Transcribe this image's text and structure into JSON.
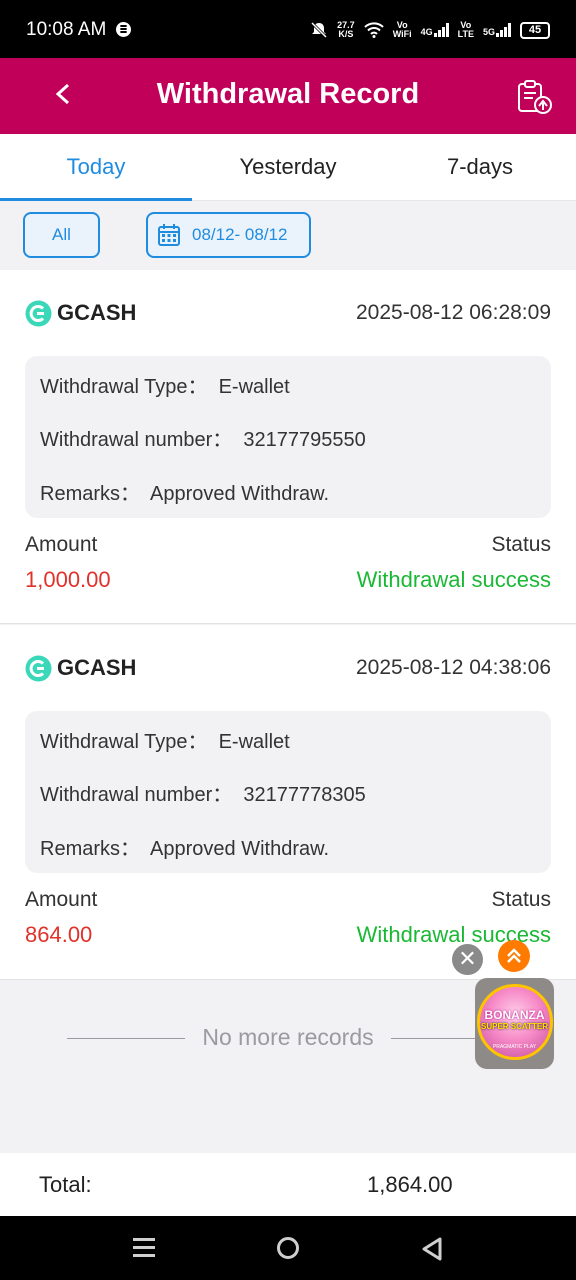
{
  "status_bar": {
    "time": "10:08 AM",
    "net_speed": "27.7",
    "net_unit": "K/S",
    "wifi_label_top": "Vo",
    "wifi_label_bottom": "WiFi",
    "lte_label": "4G",
    "lte_label_top": "Vo",
    "lte_label_bottom": "LTE",
    "fiveg_label": "5G",
    "battery": "45"
  },
  "header": {
    "title": "Withdrawal Record"
  },
  "tabs": [
    {
      "label": "Today",
      "active": true
    },
    {
      "label": "Yesterday",
      "active": false
    },
    {
      "label": "7-days",
      "active": false
    }
  ],
  "filter": {
    "all_label": "All",
    "date_range": "08/12- 08/12"
  },
  "records": [
    {
      "method": "GCASH",
      "datetime": "2025-08-12 06:28:09",
      "type_line": "Withdrawal Type：  E-wallet",
      "number_line": "Withdrawal number：  32177795550",
      "remarks_line": "Remarks：  Approved Withdraw.",
      "amount_label": "Amount",
      "status_label": "Status",
      "amount": "1,000.00",
      "status": "Withdrawal success"
    },
    {
      "method": "GCASH",
      "datetime": "2025-08-12 04:38:06",
      "type_line": "Withdrawal Type：  E-wallet",
      "number_line": "Withdrawal number：  32177778305",
      "remarks_line": "Remarks：  Approved Withdraw.",
      "amount_label": "Amount",
      "status_label": "Status",
      "amount": "864.00",
      "status": "Withdrawal success"
    }
  ],
  "no_more": "No more records",
  "total": {
    "label": "Total:",
    "value": "1,864.00"
  },
  "floating_ad": {
    "title_1": "BONANZA",
    "title_2": "SUPER SCATTER",
    "brand": "PRAGMATIC PLAY"
  },
  "colors": {
    "header_bg": "#c1005a",
    "accent": "#1f8ce0",
    "amount": "#e0322b",
    "success": "#1ab834"
  }
}
